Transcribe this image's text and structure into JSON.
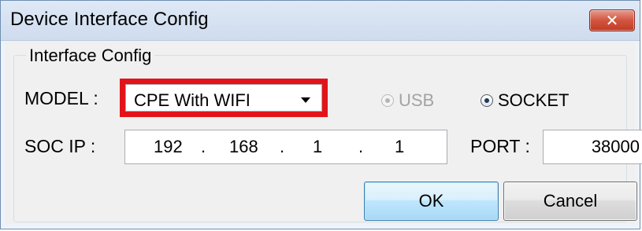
{
  "window": {
    "title": "Device Interface Config",
    "close_glyph": "✕"
  },
  "group": {
    "label": "Interface Config"
  },
  "model": {
    "label": "MODEL :",
    "selected": "CPE With WIFI",
    "highlight_color": "#e2141a"
  },
  "connection": {
    "options": [
      {
        "label": "USB",
        "selected": false,
        "enabled": false
      },
      {
        "label": "SOCKET",
        "selected": true,
        "enabled": true
      }
    ]
  },
  "soc_ip": {
    "label": "SOC IP :",
    "octets": [
      "192",
      "168",
      "1",
      "1"
    ],
    "separator": "."
  },
  "port": {
    "label": "PORT :",
    "value": "38000"
  },
  "buttons": {
    "ok": "OK",
    "cancel": "Cancel"
  }
}
